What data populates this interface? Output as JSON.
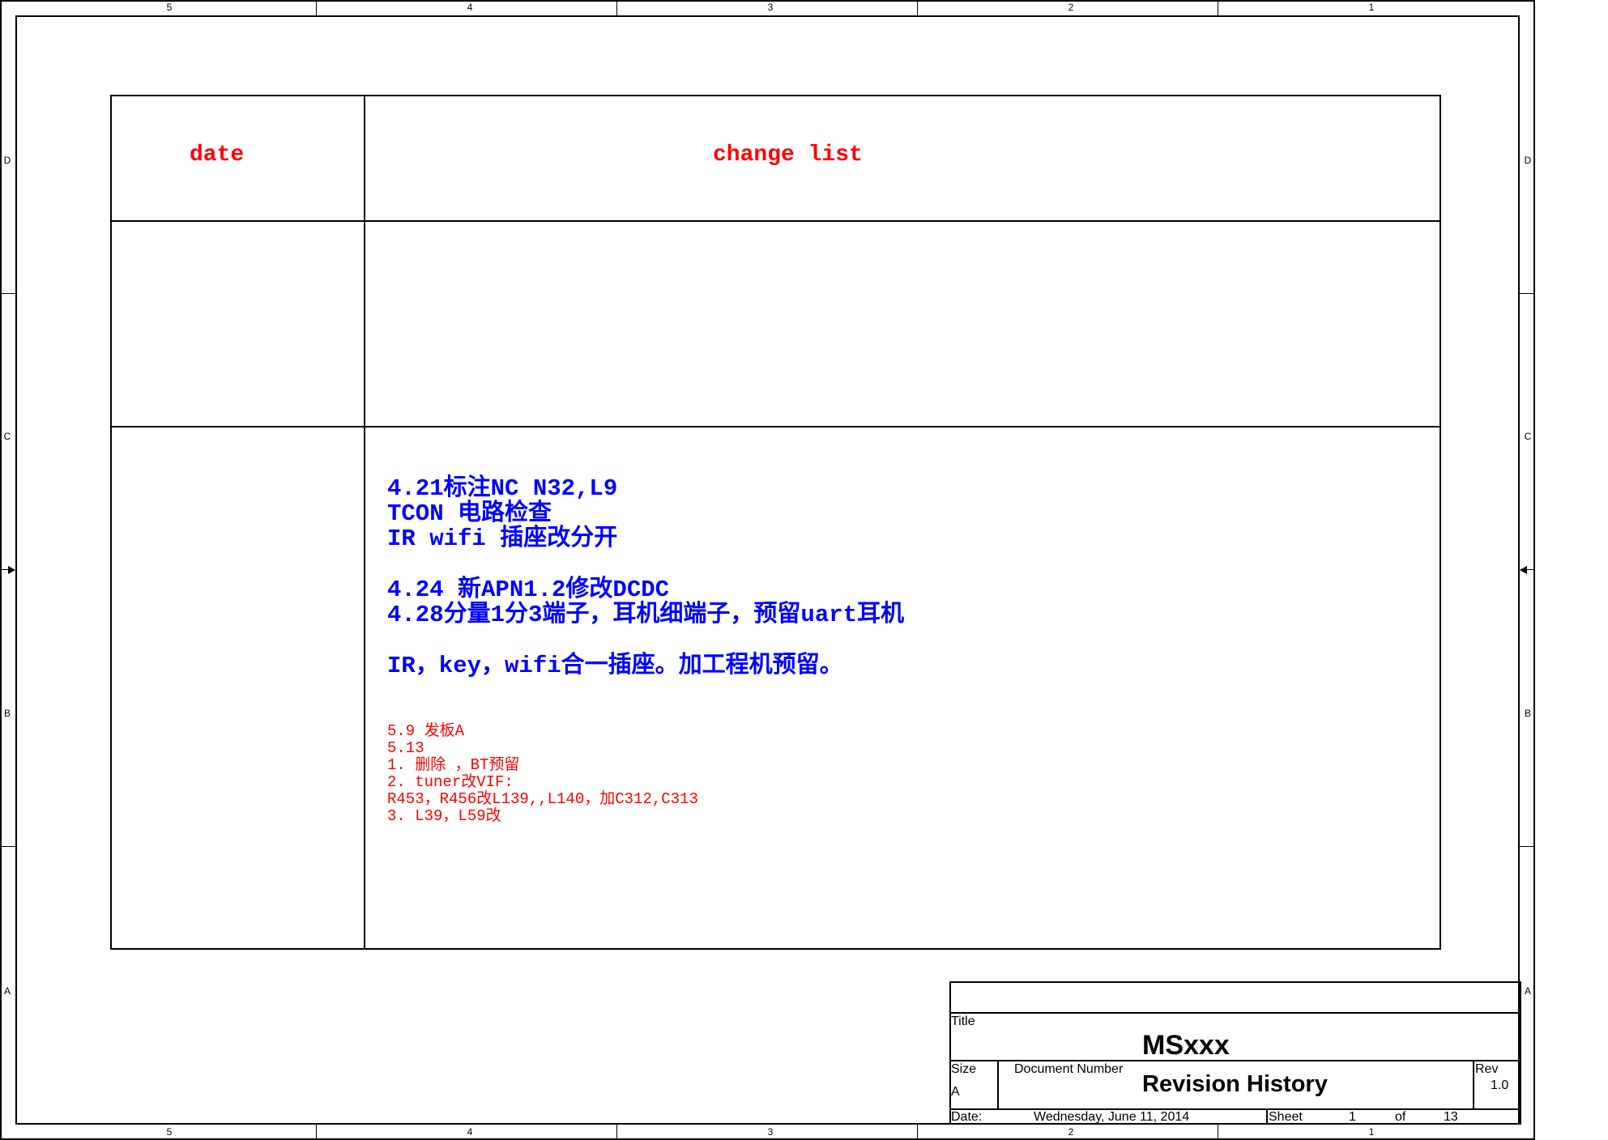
{
  "border": {
    "columns": [
      "5",
      "4",
      "3",
      "2",
      "1"
    ],
    "rows": [
      "D",
      "C",
      "B",
      "A"
    ]
  },
  "revision_table": {
    "header_date": "date",
    "header_changes": "change list",
    "entries_blue": [
      "4.21标注NC N32,L9",
      "TCON 电路检查",
      "IR wifi 插座改分开",
      "4.24 新APN1.2修改DCDC",
      "4.28分量1分3端子，耳机细端子，预留uart耳机",
      "IR，key，wifi合一插座。加工程机预留。"
    ],
    "entries_red": [
      "5.9 发板A",
      "5.13",
      "1. 删除 ，BT预留",
      "2. tuner改VIF:",
      " R453，R456改L139,,L140，加C312,C313",
      "3. L39，L59改"
    ]
  },
  "title_block": {
    "title_label": "Title",
    "title_value": "MSxxx",
    "size_label": "Size",
    "size_value": "A",
    "docnum_label": "Document Number",
    "docnum_value": "Revision History",
    "rev_label": "Rev",
    "rev_value": "1.0",
    "date_label": "Date:",
    "date_value": "Wednesday, June 11, 2014",
    "sheet_label": "Sheet",
    "sheet_value": "1",
    "of_label": "of",
    "of_value": "13"
  }
}
